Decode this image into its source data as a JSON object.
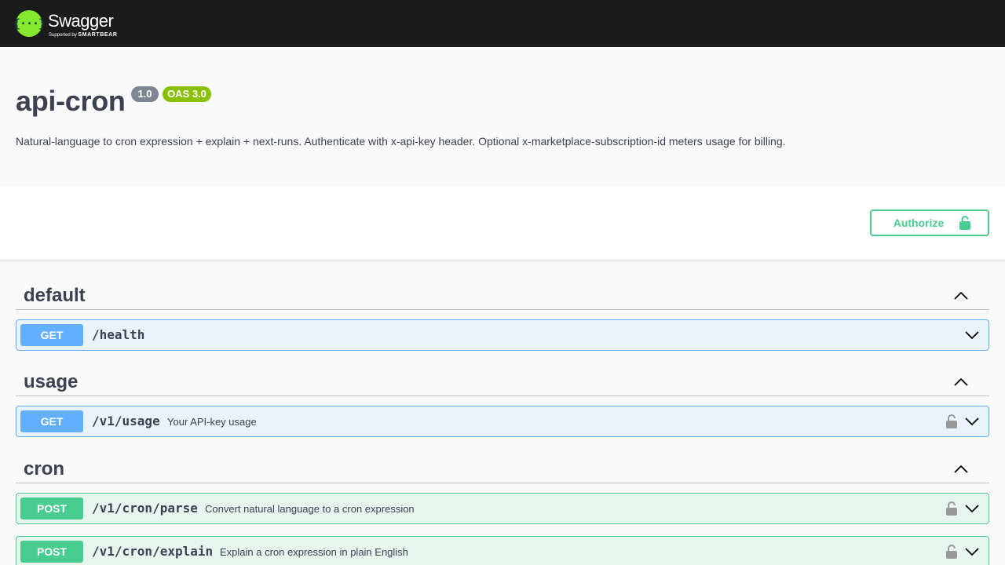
{
  "topbar": {
    "logo_mark": "{···}",
    "logo_name": "Swagger",
    "logo_sub_prefix": "Supported by",
    "logo_sub_brand": "SMARTBEAR"
  },
  "info": {
    "title": "api-cron",
    "version": "1.0",
    "oas": "OAS 3.0",
    "description": "Natural-language to cron expression + explain + next-runs. Authenticate with x-api-key header. Optional x-marketplace-subscription-id meters usage for billing."
  },
  "authorize": {
    "label": "Authorize",
    "icon": "unlocked-lock-icon"
  },
  "tags": [
    {
      "name": "default",
      "operations": [
        {
          "method": "GET",
          "path": "/health",
          "summary": "",
          "locked": false
        }
      ]
    },
    {
      "name": "usage",
      "operations": [
        {
          "method": "GET",
          "path": "/v1/usage",
          "summary": "Your API-key usage",
          "locked": true
        }
      ]
    },
    {
      "name": "cron",
      "operations": [
        {
          "method": "POST",
          "path": "/v1/cron/parse",
          "summary": "Convert natural language to a cron expression",
          "locked": true
        },
        {
          "method": "POST",
          "path": "/v1/cron/explain",
          "summary": "Explain a cron expression in plain English",
          "locked": true
        }
      ]
    }
  ],
  "colors": {
    "topbar": "#1b1b1b",
    "get": "#61affe",
    "post": "#49cc90",
    "text": "#3b4151",
    "oas_badge": "#89bf04",
    "version_badge": "#7d8492"
  }
}
